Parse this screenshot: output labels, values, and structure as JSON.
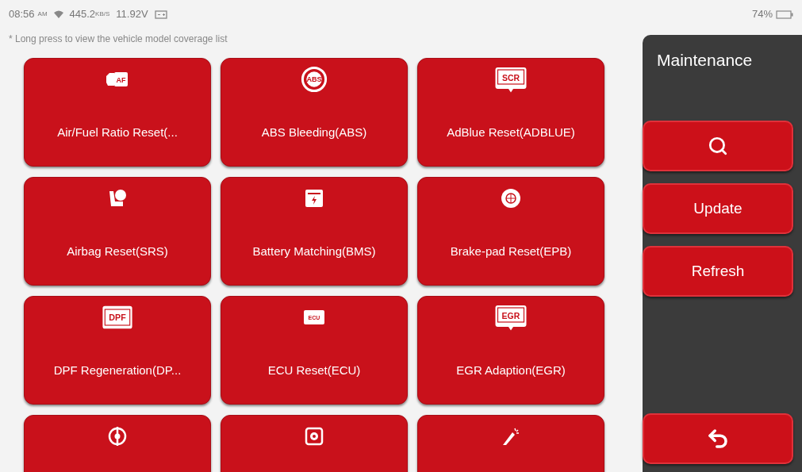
{
  "status_bar": {
    "time": "08:56",
    "ampm": "AM",
    "speed": "445.2",
    "speed_unit": "KB/S",
    "voltage": "11.92V",
    "battery": "74%"
  },
  "hint": "* Long press to view the vehicle model coverage list",
  "tiles": [
    {
      "kind": "car",
      "icon_text": "AF",
      "label": "Air/Fuel Ratio Reset(..."
    },
    {
      "kind": "circle",
      "icon_text": "ABS",
      "label": "ABS Bleeding(ABS)"
    },
    {
      "kind": "screen",
      "icon_text": "SCR",
      "label": "AdBlue Reset(ADBLUE)"
    },
    {
      "kind": "airbag",
      "label": "Airbag Reset(SRS)"
    },
    {
      "kind": "battery",
      "label": "Battery Matching(BMS)"
    },
    {
      "kind": "disc",
      "label": "Brake-pad Reset(EPB)"
    },
    {
      "kind": "frame",
      "icon_text": "DPF",
      "label": "DPF Regeneration(DP..."
    },
    {
      "kind": "tag",
      "icon_text": "ECU",
      "label": "ECU Reset(ECU)"
    },
    {
      "kind": "screen",
      "icon_text": "EGR",
      "label": "EGR Adaption(EGR)"
    },
    {
      "kind": "compass"
    },
    {
      "kind": "gear"
    },
    {
      "kind": "injector"
    }
  ],
  "panel": {
    "title": "Maintenance",
    "buttons": [
      {
        "kind": "search"
      },
      {
        "kind": "text",
        "label": "Update"
      },
      {
        "kind": "text",
        "label": "Refresh"
      }
    ],
    "back": {
      "kind": "back"
    }
  }
}
